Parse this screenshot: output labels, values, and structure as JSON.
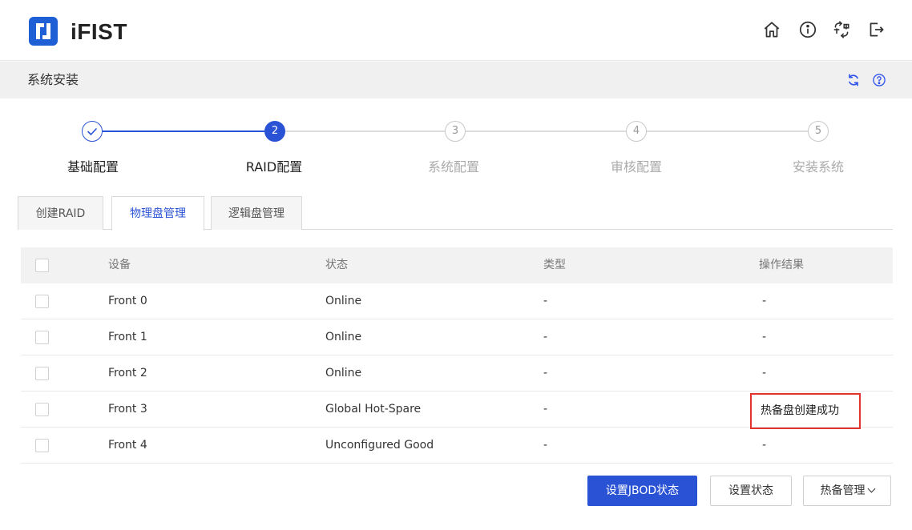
{
  "header": {
    "brand": "iFIST",
    "brand_color": "#1f5fd6"
  },
  "subbar": {
    "title": "系统安装"
  },
  "steps": [
    {
      "number": "",
      "label": "基础配置",
      "state": "done"
    },
    {
      "number": "2",
      "label": "RAID配置",
      "state": "active"
    },
    {
      "number": "3",
      "label": "系统配置",
      "state": "pending"
    },
    {
      "number": "4",
      "label": "审核配置",
      "state": "pending"
    },
    {
      "number": "5",
      "label": "安装系统",
      "state": "pending"
    }
  ],
  "tabs": [
    {
      "label": "创建RAID",
      "active": false
    },
    {
      "label": "物理盘管理",
      "active": true
    },
    {
      "label": "逻辑盘管理",
      "active": false
    }
  ],
  "table": {
    "headers": [
      "设备",
      "状态",
      "类型",
      "操作结果"
    ],
    "rows": [
      {
        "device": "Front 0",
        "status": "Online",
        "type": "-",
        "result": "-"
      },
      {
        "device": "Front 1",
        "status": "Online",
        "type": "-",
        "result": "-"
      },
      {
        "device": "Front 2",
        "status": "Online",
        "type": "-",
        "result": "-"
      },
      {
        "device": "Front 3",
        "status": "Global Hot-Spare",
        "type": "-",
        "result": "热备盘创建成功"
      },
      {
        "device": "Front 4",
        "status": "Unconfigured Good",
        "type": "-",
        "result": "-"
      }
    ]
  },
  "buttons": {
    "set_jbod": "设置JBOD状态",
    "set_state": "设置状态",
    "hotspare": "热备管理"
  },
  "colors": {
    "primary": "#2a52d4",
    "highlight_border": "#e0342c"
  }
}
